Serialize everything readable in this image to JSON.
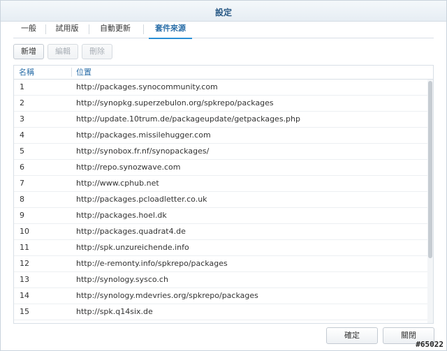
{
  "window": {
    "title": "設定"
  },
  "tabs": [
    {
      "label": "一般",
      "active": false
    },
    {
      "label": "試用版",
      "active": false
    },
    {
      "label": "自動更新",
      "active": false
    },
    {
      "label": "套件來源",
      "active": true
    }
  ],
  "toolbar": {
    "add_label": "新增",
    "edit_label": "編輯",
    "delete_label": "刪除"
  },
  "table": {
    "columns": [
      "名稱",
      "位置"
    ],
    "rows": [
      {
        "name": "1",
        "location": "http://packages.synocommunity.com"
      },
      {
        "name": "2",
        "location": "http://synopkg.superzebulon.org/spkrepo/packages"
      },
      {
        "name": "3",
        "location": "http://update.10trum.de/packageupdate/getpackages.php"
      },
      {
        "name": "4",
        "location": "http://packages.missilehugger.com"
      },
      {
        "name": "5",
        "location": "http://synobox.fr.nf/synopackages/"
      },
      {
        "name": "6",
        "location": "http://repo.synozwave.com"
      },
      {
        "name": "7",
        "location": "http://www.cphub.net"
      },
      {
        "name": "8",
        "location": "http://packages.pcloadletter.co.uk"
      },
      {
        "name": "9",
        "location": "http://packages.hoel.dk"
      },
      {
        "name": "10",
        "location": "http://packages.quadrat4.de"
      },
      {
        "name": "11",
        "location": "http://spk.unzureichende.info"
      },
      {
        "name": "12",
        "location": "http://e-remonty.info/spkrepo/packages"
      },
      {
        "name": "13",
        "location": "http://synology.sysco.ch"
      },
      {
        "name": "14",
        "location": "http://synology.mdevries.org/spkrepo/packages"
      },
      {
        "name": "15",
        "location": "http://spk.q14six.de"
      }
    ]
  },
  "footer": {
    "ok_label": "確定",
    "close_label": "關閉"
  },
  "watermark": "#65022",
  "colors": {
    "accent": "#2a6ea8",
    "title": "#2a5a86",
    "active_tab_underline": "#2a8fd6"
  }
}
